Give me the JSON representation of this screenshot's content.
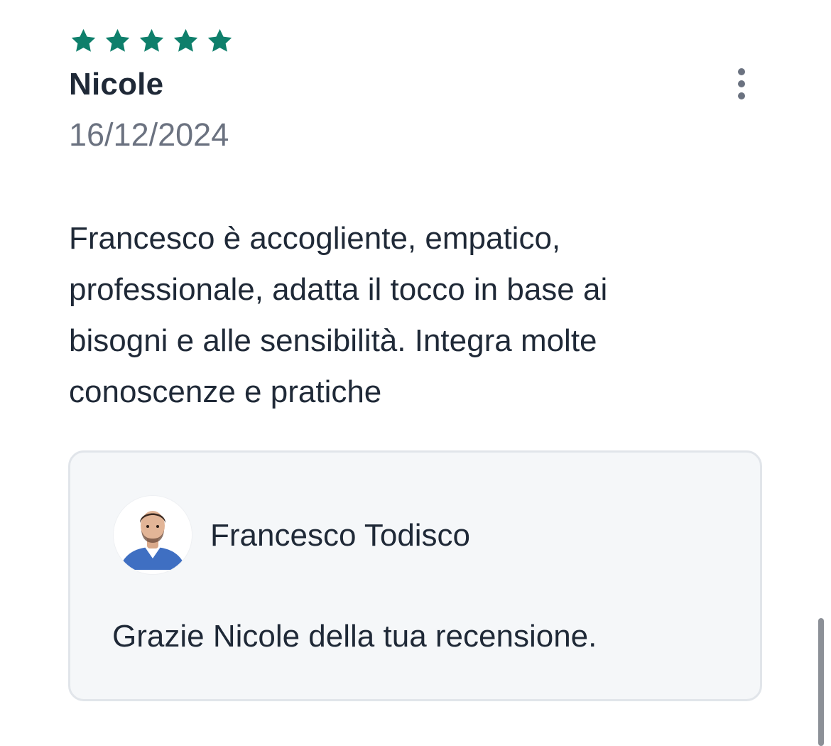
{
  "review": {
    "rating": 5,
    "rating_max": 5,
    "star_color": "#0e7f6b",
    "reviewer_name": "Nicole",
    "date": "16/12/2024",
    "text": "Francesco è accogliente, empatico, professionale, adatta il tocco in base ai bisogni e alle sensibilità. Integra molte conoscenze e pratiche"
  },
  "menu": {
    "icon": "more-vertical-icon"
  },
  "reply": {
    "author_name": "Francesco Todisco",
    "text": "Grazie Nicole della tua recensione."
  },
  "colors": {
    "text_primary": "#1f2937",
    "text_secondary": "#6b7280",
    "reply_background": "#f5f7f9",
    "reply_border": "#e1e5ea"
  }
}
